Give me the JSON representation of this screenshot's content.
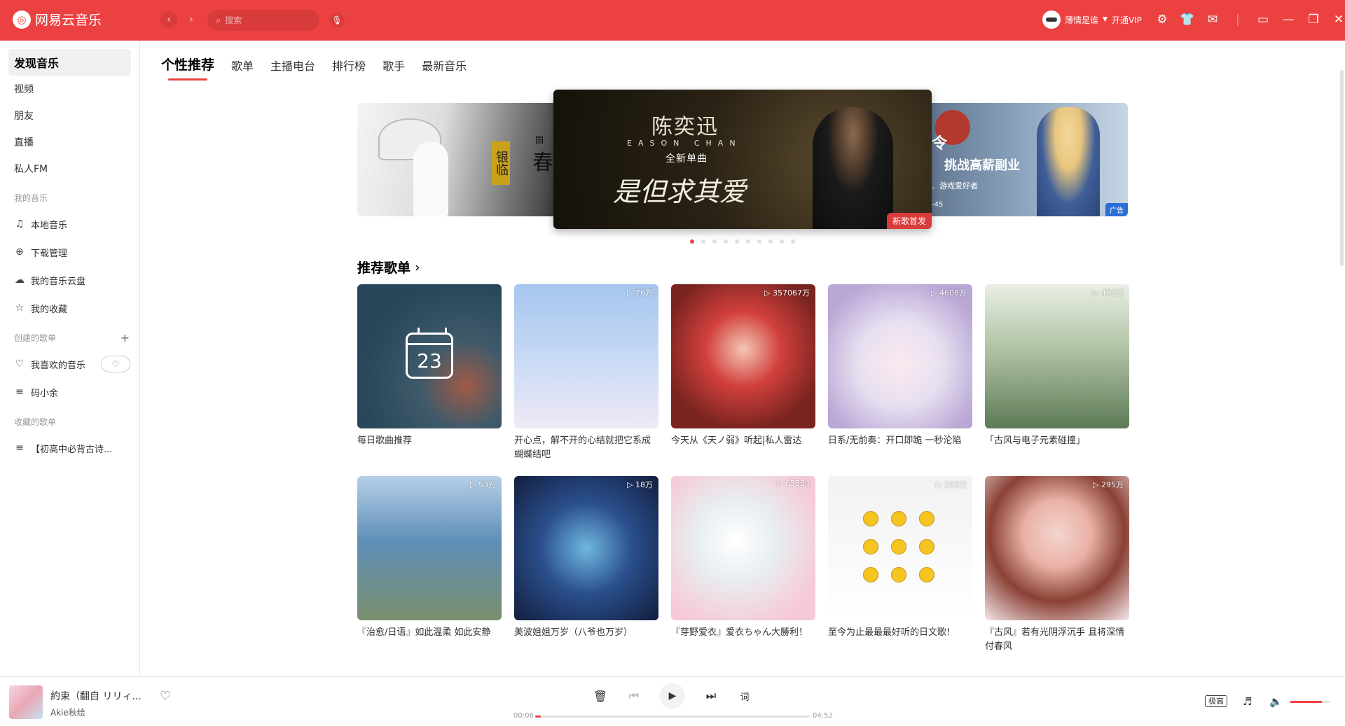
{
  "app": {
    "title": "网易云音乐"
  },
  "search": {
    "placeholder": "搜索"
  },
  "user": {
    "name": "薄情是谁",
    "vip": "开通VIP"
  },
  "colors": {
    "brand": "#ec4141",
    "accent": "#ec4141"
  },
  "icons": {
    "settings": "gear-icon",
    "skin": "shirt-icon",
    "mail": "mail-icon",
    "mini": "mini-mode-icon",
    "minimize": "minimize-icon",
    "maximize": "maximize-icon",
    "close": "close-icon"
  },
  "sidebar": {
    "main": [
      {
        "label": "发现音乐"
      },
      {
        "label": "视频"
      },
      {
        "label": "朋友"
      },
      {
        "label": "直播"
      },
      {
        "label": "私人FM"
      }
    ],
    "my_music_title": "我的音乐",
    "my_music": [
      {
        "label": "本地音乐"
      },
      {
        "label": "下载管理"
      },
      {
        "label": "我的音乐云盘"
      },
      {
        "label": "我的收藏"
      }
    ],
    "created_title": "创建的歌单",
    "created": [
      {
        "label": "我喜欢的音乐"
      },
      {
        "label": "码小余"
      }
    ],
    "collected_title": "收藏的歌单",
    "collected": [
      {
        "label": "【初高中必背古诗..."
      }
    ]
  },
  "tabs": [
    "个性推荐",
    "歌单",
    "主播电台",
    "排行榜",
    "歌手",
    "最新音乐"
  ],
  "banner": {
    "left_stamp": "银临",
    "left_char": "春",
    "left_small": "国",
    "center_name": "陈奕迅",
    "center_en": "EASON CHAN",
    "center_sub": "全新单曲",
    "center_title": "是但求其爱",
    "center_tag": "新歌首发",
    "right_t1": "令",
    "right_t2": "挑战高薪副业",
    "right_t3": "、游戏爱好者",
    "right_t4": "-45",
    "right_tag": "广告",
    "dots_count": 10,
    "active_dot": 0
  },
  "section": {
    "title": "推荐歌单"
  },
  "playlists": [
    {
      "label": "每日歌曲推荐",
      "count": "",
      "calendar_day": "23"
    },
    {
      "label": "开心点，解不开的心结就把它系成蝴蝶结吧",
      "count": "76万"
    },
    {
      "label": "今天从《天ノ弱》听起|私人雷达",
      "count": "357067万"
    },
    {
      "label": "日系/无前奏：开口即跪 一秒沦陷",
      "count": "4608万"
    },
    {
      "label": "「古风与电子元素碰撞」",
      "count": "453万"
    },
    {
      "label": "『治愈/日语』如此温柔 如此安静",
      "count": "53万"
    },
    {
      "label": "美波姐姐万岁（八爷也万岁）",
      "count": "18万"
    },
    {
      "label": "『芽野爱衣』爱衣ちゃん大勝利！",
      "count": "65384"
    },
    {
      "label": "至今为止最最最好听的日文歌!",
      "count": "293万"
    },
    {
      "label": "『古风』若有光阴浮沉手 且将深情付春风",
      "count": "295万"
    }
  ],
  "player": {
    "title": "約束（翻自 リリィ...",
    "artist": "Akie秋绘",
    "current_time": "00:06",
    "total_time": "04:52",
    "progress": 0.02,
    "quality": "极高",
    "volume": 0.8
  }
}
